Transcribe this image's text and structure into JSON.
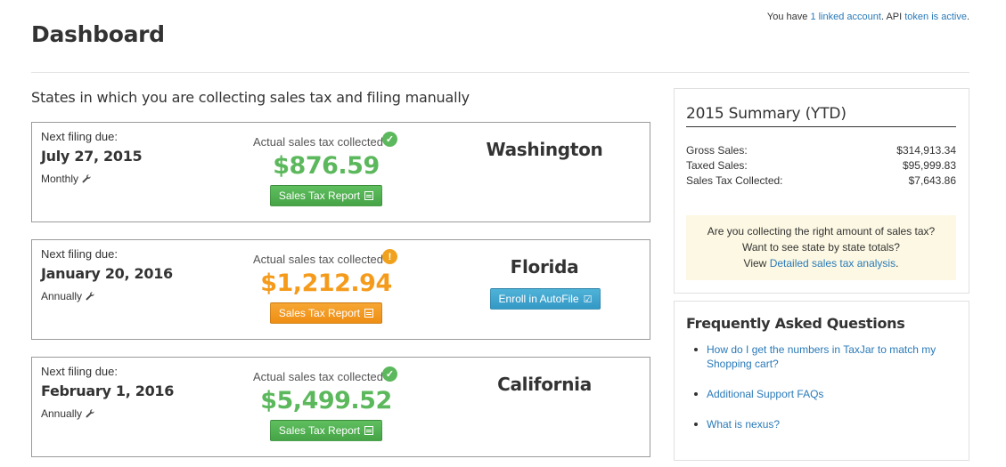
{
  "topbar": {
    "prefix": "You have ",
    "linked_link": "1 linked account",
    "middle": ". API ",
    "token_link": "token is active"
  },
  "page": {
    "title": "Dashboard"
  },
  "section": {
    "heading": "States in which you are collecting sales tax and filing manually"
  },
  "filings": [
    {
      "due_label": "Next filing due:",
      "due_date": "July 27, 2015",
      "frequency": "Monthly",
      "collected_label": "Actual sales tax collected",
      "status": "ok",
      "amount": "$876.59",
      "report_label": "Sales Tax Report",
      "state": "Washington",
      "accent": "#5cb85c"
    },
    {
      "due_label": "Next filing due:",
      "due_date": "January 20, 2016",
      "frequency": "Annually",
      "collected_label": "Actual sales tax collected",
      "status": "warning",
      "amount": "$1,212.94",
      "report_label": "Sales Tax Report",
      "state": "Florida",
      "autofile_label": "Enroll in AutoFile",
      "accent": "#f59b1c"
    },
    {
      "due_label": "Next filing due:",
      "due_date": "February 1, 2016",
      "frequency": "Annually",
      "collected_label": "Actual sales tax collected",
      "status": "ok",
      "amount": "$5,499.52",
      "report_label": "Sales Tax Report",
      "state": "California",
      "accent": "#5cb85c"
    }
  ],
  "summary": {
    "title": "2015 Summary (YTD)",
    "rows": [
      {
        "label": "Gross Sales:",
        "value": "$314,913.34"
      },
      {
        "label": "Taxed Sales:",
        "value": "$95,999.83"
      },
      {
        "label": "Sales Tax Collected:",
        "value": "$7,643.86"
      }
    ],
    "callout": {
      "line1": "Are you collecting the right amount of sales tax?",
      "line2": "Want to see state by state totals?",
      "line3_prefix": "View ",
      "line3_link": "Detailed sales tax analysis",
      "line3_suffix": "."
    }
  },
  "faq": {
    "title": "Frequently Asked Questions",
    "items": [
      "How do I get the numbers in TaxJar to match my Shopping cart?",
      "Additional Support FAQs",
      "What is nexus?"
    ]
  }
}
